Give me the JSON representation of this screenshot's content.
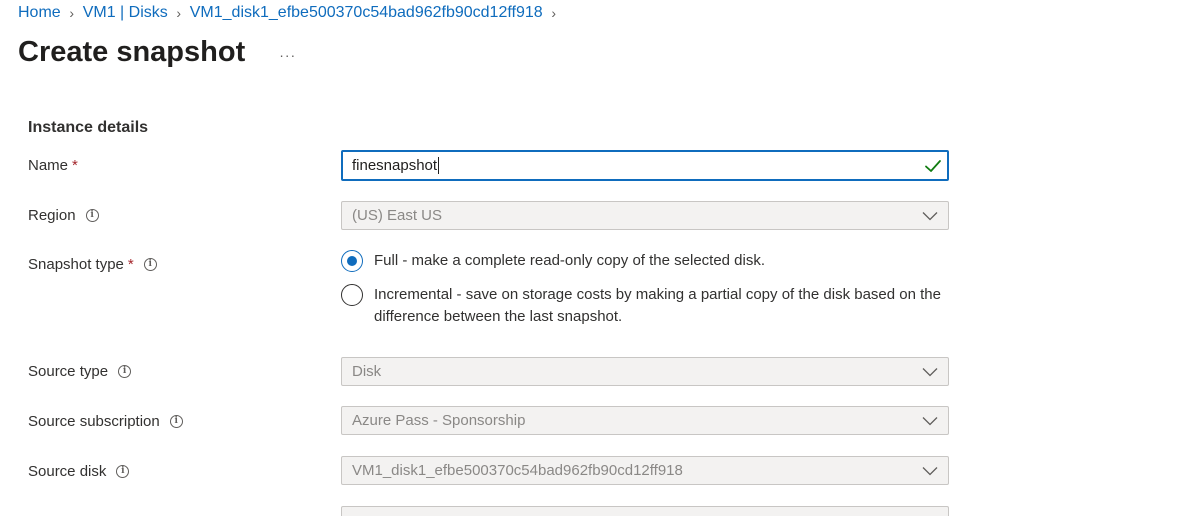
{
  "breadcrumb": {
    "items": [
      "Home",
      "VM1 | Disks",
      "VM1_disk1_efbe500370c54bad962fb90cd12ff918"
    ]
  },
  "page": {
    "title": "Create snapshot",
    "more_label": "···"
  },
  "section": {
    "title": "Instance details"
  },
  "fields": {
    "name": {
      "label": "Name",
      "required": "*",
      "value": "finesnapshot"
    },
    "region": {
      "label": "Region",
      "value": "(US) East US"
    },
    "snapshot_type": {
      "label": "Snapshot type",
      "required": "*",
      "options": [
        {
          "label": "Full - make a complete read-only copy of the selected disk.",
          "selected": true
        },
        {
          "label": "Incremental - save on storage costs by making a partial copy of the disk based on the difference between the last snapshot.",
          "selected": false
        }
      ]
    },
    "source_type": {
      "label": "Source type",
      "value": "Disk"
    },
    "source_subscription": {
      "label": "Source subscription",
      "value": "Azure Pass - Sponsorship"
    },
    "source_disk": {
      "label": "Source disk",
      "value": "VM1_disk1_efbe500370c54bad962fb90cd12ff918"
    }
  },
  "icons": {
    "info": "i",
    "chevron_separator": "›"
  },
  "colors": {
    "accent": "#0f6cbd",
    "required": "#a4262c",
    "valid_check": "#107c10",
    "disabled_bg": "#f3f2f1"
  }
}
